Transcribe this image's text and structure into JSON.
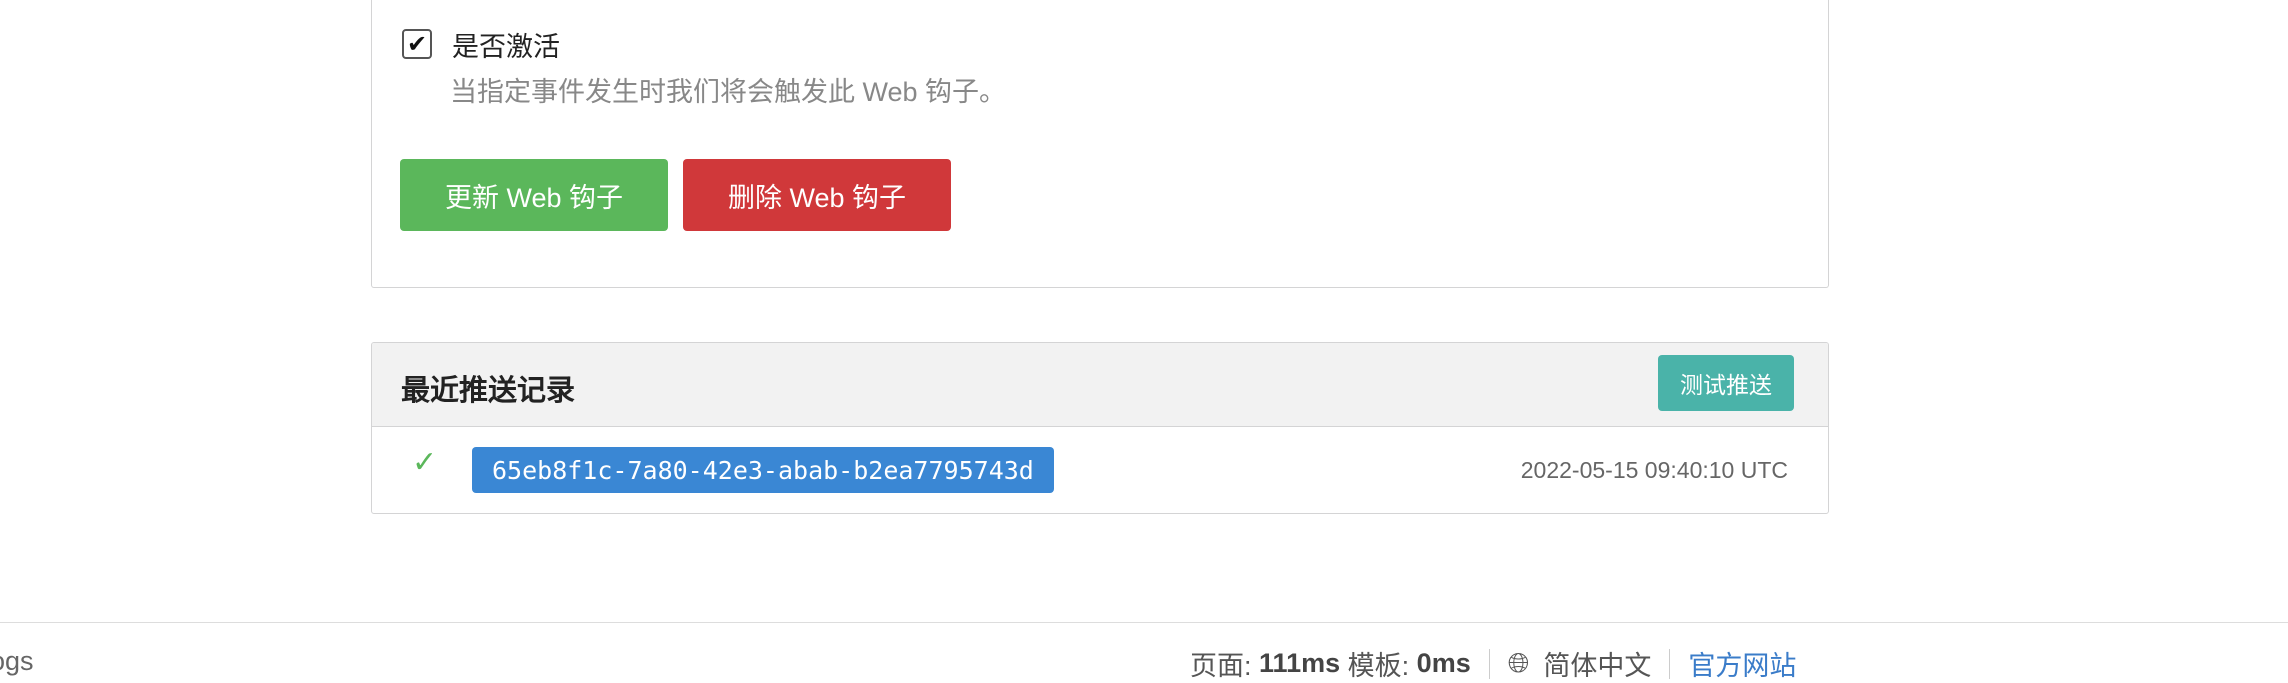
{
  "webhook_form": {
    "active_label": "是否激活",
    "active_checked": true,
    "active_help": "当指定事件发生时我们将会触发此 Web 钩子。",
    "update_button": "更新 Web 钩子",
    "delete_button": "删除 Web 钩子"
  },
  "deliveries": {
    "title": "最近推送记录",
    "test_button": "测试推送",
    "items": [
      {
        "status": "success",
        "status_icon": "check-icon",
        "uuid": "65eb8f1c-7a80-42e3-abab-b2ea7795743d",
        "time": "2022-05-15 09:40:10 UTC"
      }
    ]
  },
  "footer": {
    "left_text": "ogs",
    "page_label": "页面:",
    "page_time": "111ms",
    "template_label": "模板:",
    "template_time": "0ms",
    "language": "简体中文",
    "official_site": "官方网站"
  },
  "colors": {
    "update": "#5bb75b",
    "delete": "#d0383a",
    "test": "#4ab3a9",
    "uuid": "#3a87d4",
    "link": "#3a7cc9"
  }
}
